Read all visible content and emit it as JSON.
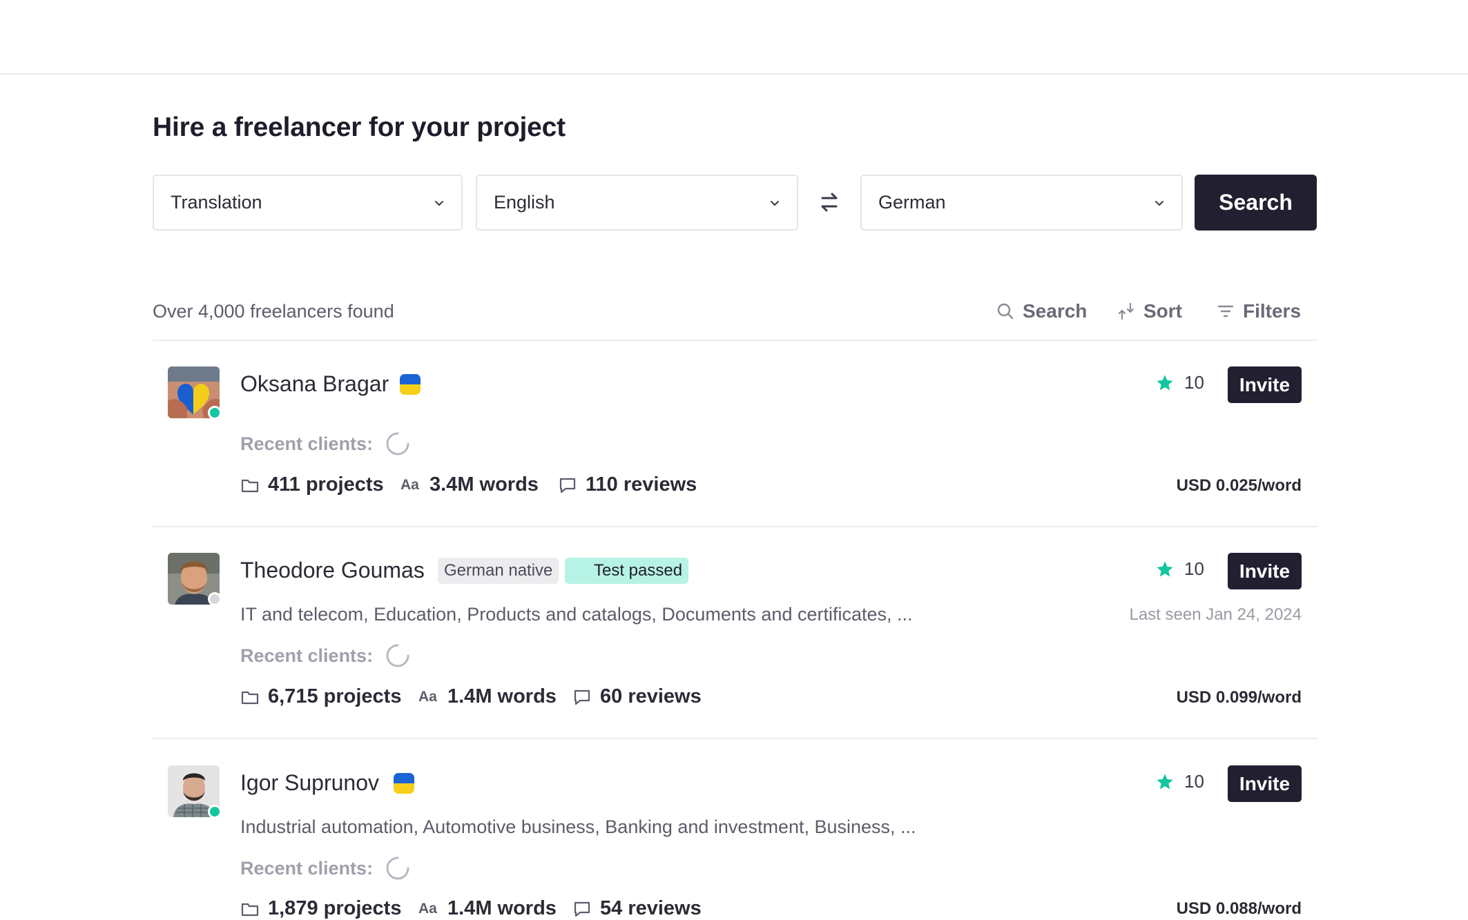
{
  "page": {
    "title": "Hire a freelancer for your project"
  },
  "filters": {
    "service": "Translation",
    "source_language": "English",
    "target_language": "German",
    "search_label": "Search"
  },
  "results": {
    "count_text": "Over 4,000 freelancers found",
    "tools": {
      "search": "Search",
      "sort": "Sort",
      "filters": "Filters"
    }
  },
  "freelancers": [
    {
      "name": "Oksana Bragar",
      "flag": "ukraine-flag",
      "online": true,
      "rating": "10",
      "invite": "Invite",
      "recent_clients_label": "Recent clients:",
      "projects": "411 projects",
      "words": "3.4M words",
      "reviews": "110 reviews",
      "price": "USD 0.025/word"
    },
    {
      "name": "Theodore Goumas",
      "badges": [
        "German native",
        "Test passed"
      ],
      "online": false,
      "rating": "10",
      "invite": "Invite",
      "specializations": "IT and telecom, Education, Products and catalogs, Documents and certificates, ...",
      "last_seen": "Last seen Jan 24, 2024",
      "recent_clients_label": "Recent clients:",
      "projects": "6,715 projects",
      "words": "1.4M words",
      "reviews": "60 reviews",
      "price": "USD 0.099/word"
    },
    {
      "name": "Igor Suprunov",
      "flag": "ukraine-flag",
      "online": true,
      "rating": "10",
      "invite": "Invite",
      "specializations": "Industrial automation, Automotive business, Banking and investment, Business, ...",
      "recent_clients_label": "Recent clients:",
      "projects": "1,879 projects",
      "words": "1.4M words",
      "reviews": "54 reviews",
      "price": "USD 0.088/word"
    }
  ],
  "words_icon_text": "Aa",
  "colors": {
    "primary": "#221f31",
    "accent": "#12c6a0",
    "online": "#12c6a0",
    "offline": "#d6d6dc"
  }
}
